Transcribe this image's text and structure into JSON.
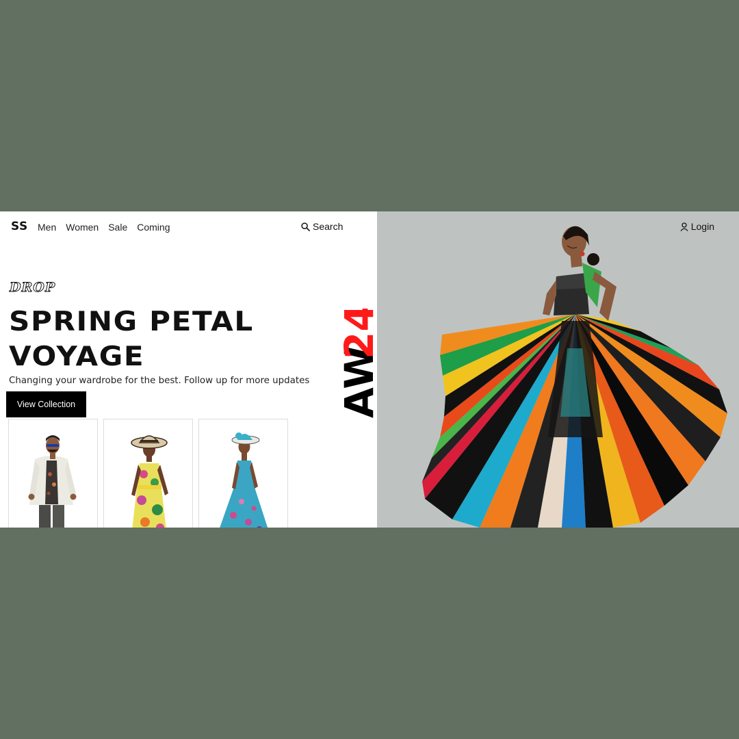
{
  "brand": {
    "logo": "SS"
  },
  "nav": {
    "items": [
      "Men",
      "Women",
      "Sale",
      "Coming"
    ]
  },
  "search": {
    "label": "Search"
  },
  "account": {
    "login_label": "Login"
  },
  "hero": {
    "kicker": "DROP",
    "title_line1": "SPRING PETAL",
    "title_line2": "VOYAGE",
    "subtitle": "Changing your wardrobe for the best. Follow up for more updates",
    "cta_label": "View Collection"
  },
  "season": {
    "prefix": "AW",
    "year": "24",
    "prefix_color": "#000000",
    "year_color": "#ff1a1a"
  },
  "products": [
    {
      "name": "man-in-white-jacket"
    },
    {
      "name": "woman-in-floral-dress-with-hat"
    },
    {
      "name": "woman-in-blue-gown-with-hat"
    }
  ],
  "colors": {
    "background": "#617060",
    "left_panel": "#ffffff",
    "right_panel": "#bec3c2",
    "cta_bg": "#000000"
  }
}
